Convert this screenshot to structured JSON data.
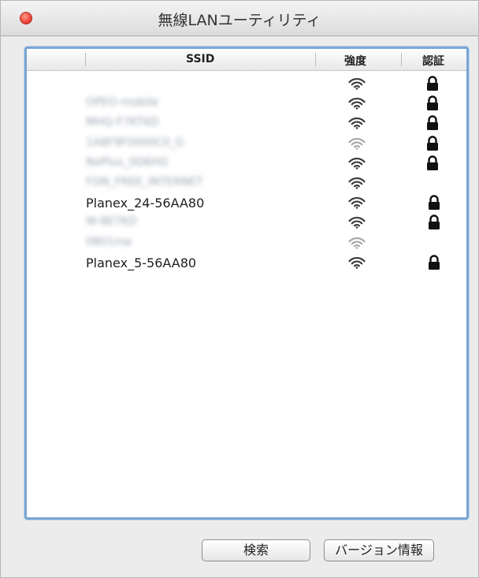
{
  "window": {
    "title": "無線LANユーティリティ"
  },
  "table": {
    "headers": {
      "ssid": "SSID",
      "strength": "強度",
      "auth": "認証"
    },
    "rows": [
      {
        "ssid": "",
        "strength": "strong",
        "locked": true,
        "blurred": false
      },
      {
        "ssid": "OPEO-mobile",
        "strength": "strong",
        "locked": true,
        "blurred": true
      },
      {
        "ssid": "MHQ-F7KT6D",
        "strength": "strong",
        "locked": true,
        "blurred": true
      },
      {
        "ssid": "1A8F9F0000C0_G",
        "strength": "weak",
        "locked": true,
        "blurred": true
      },
      {
        "ssid": "NePlus_0D6HG",
        "strength": "strong",
        "locked": true,
        "blurred": true
      },
      {
        "ssid": "FON_FREE_INTERNET",
        "strength": "strong",
        "locked": false,
        "blurred": true
      },
      {
        "ssid": "Planex_24-56AA80",
        "strength": "strong",
        "locked": true,
        "blurred": false
      },
      {
        "ssid": "W-8ETKD",
        "strength": "strong",
        "locked": true,
        "blurred": true
      },
      {
        "ssid": "0801ma",
        "strength": "weak",
        "locked": false,
        "blurred": true
      },
      {
        "ssid": "Planex_5-56AA80",
        "strength": "strong",
        "locked": true,
        "blurred": false
      }
    ]
  },
  "buttons": {
    "search": "検索",
    "version": "バージョン情報"
  },
  "colors": {
    "accent": "#7aa6d6",
    "close": "#ee4b3c",
    "wifi_strong": "#3a3a3a",
    "wifi_weak": "#a8a8a8"
  },
  "icons": {
    "wifi": "wifi-icon",
    "lock": "lock-icon",
    "close": "close-icon"
  }
}
